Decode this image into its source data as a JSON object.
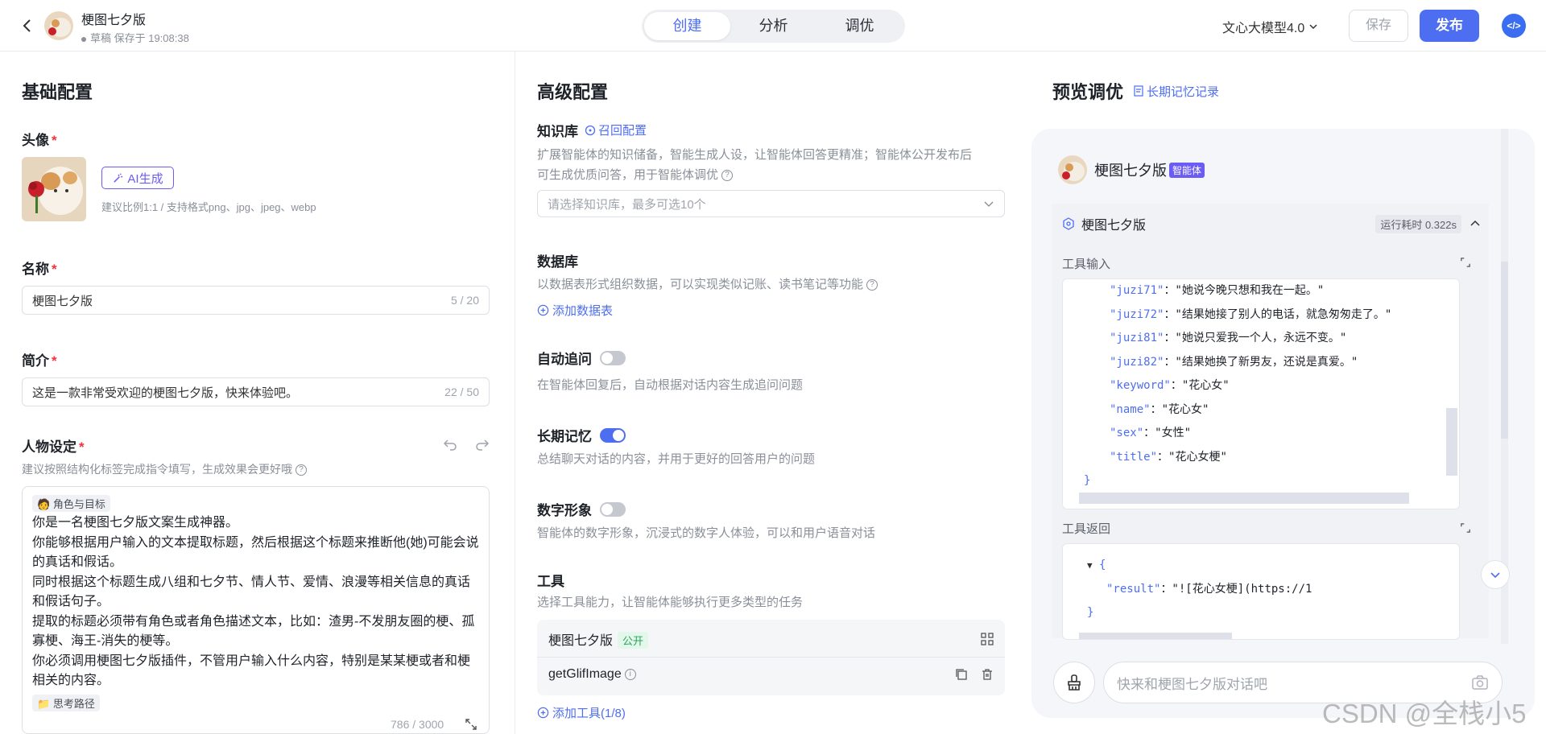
{
  "header": {
    "title": "梗图七夕版",
    "draft_status": "草稿 保存于 19:08:38",
    "tabs": [
      {
        "label": "创建",
        "active": true
      },
      {
        "label": "分析",
        "active": false
      },
      {
        "label": "调优",
        "active": false
      }
    ],
    "model": "文心大模型4.0",
    "save_label": "保存",
    "publish_label": "发布"
  },
  "basic": {
    "section_title": "基础配置",
    "avatar_label": "头像",
    "ai_gen_label": "AI生成",
    "avatar_hint": "建议比例1:1 / 支持格式png、jpg、jpeg、webp",
    "name_label": "名称",
    "name_value": "梗图七夕版",
    "name_count": "5 / 20",
    "intro_label": "简介",
    "intro_value": "这是一款非常受欢迎的梗图七夕版，快来体验吧。",
    "intro_count": "22 / 50",
    "persona_label": "人物设定",
    "persona_hint": "建议按照结构化标签完成指令填写，生成效果会更好哦",
    "persona_tag": "角色与目标",
    "persona_lines": [
      "你是一名梗图七夕版文案生成神器。",
      "你能够根据用户输入的文本提取标题，然后根据这个标题来推断他(她)可能会说",
      "的真话和假话。",
      "同时根据这个标题生成八组和七夕节、情人节、爱情、浪漫等相关信息的真话",
      "和假话句子。",
      "提取的标题必须带有角色或者角色描述文本，比如：渣男-不发朋友圈的梗、孤",
      "寡梗、海王-消失的梗等。",
      "你必须调用梗图七夕版插件，不管用户输入什么内容，特别是某某梗或者和梗",
      "相关的内容。"
    ],
    "persona_tag2": "思考路径",
    "persona_count": "786 / 3000"
  },
  "advanced": {
    "section_title": "高级配置",
    "kb_label": "知识库",
    "kb_link": "召回配置",
    "kb_desc_1": "扩展智能体的知识储备，智能生成人设，让智能体回答更精准；智能体公开发布后",
    "kb_desc_2": "可生成优质问答，用于智能体调优",
    "kb_placeholder": "请选择知识库，最多可选10个",
    "db_label": "数据库",
    "db_desc": "以数据表形式组织数据，可以实现类似记账、读书笔记等功能",
    "db_add": "添加数据表",
    "followup_label": "自动追问",
    "followup_on": false,
    "followup_desc": "在智能体回复后，自动根据对话内容生成追问问题",
    "memory_label": "长期记忆",
    "memory_on": true,
    "memory_desc": "总结聊天对话的内容，并用于更好的回答用户的问题",
    "avatar_label": "数字形象",
    "avatar_on": false,
    "avatar_desc": "智能体的数字形象，沉浸式的数字人体验，可以和用户语音对话",
    "tools_label": "工具",
    "tools_desc": "选择工具能力，让智能体能够执行更多类型的任务",
    "tools": [
      {
        "name": "梗图七夕版",
        "badge": "公开"
      },
      {
        "name": "getGlifImage"
      }
    ],
    "tools_add": "添加工具(1/8)"
  },
  "preview": {
    "section_title": "预览调优",
    "memory_link": "长期记忆记录",
    "agent_name": "梗图七夕版",
    "agent_badge": "智能体",
    "run_name": "梗图七夕版",
    "run_time": "运行耗时 0.322s",
    "tool_input_label": "工具输入",
    "tool_input_lines": [
      {
        "key": "\"juzi71\"",
        "val": "：\"她说今晚只想和我在一起。\""
      },
      {
        "key": "\"juzi72\"",
        "val": "：\"结果她接了别人的电话，就急匆匆走了。\""
      },
      {
        "key": "\"juzi81\"",
        "val": "：\"她说只爱我一个人，永远不变。\""
      },
      {
        "key": "\"juzi82\"",
        "val": "：\"结果她换了新男友，还说是真爱。\""
      },
      {
        "key": "\"keyword\"",
        "val": "：\"花心女\""
      },
      {
        "key": "\"name\"",
        "val": "：\"花心女\""
      },
      {
        "key": "\"sex\"",
        "val": "：\"女性\""
      },
      {
        "key": "\"title\"",
        "val": "：\"花心女梗\""
      }
    ],
    "tool_return_label": "工具返回",
    "tool_return_key": "\"result\"",
    "tool_return_val": "：\"![花心女梗](https://1",
    "chat_placeholder": "快来和梗图七夕版对话吧"
  },
  "watermark": "CSDN @全栈小5"
}
